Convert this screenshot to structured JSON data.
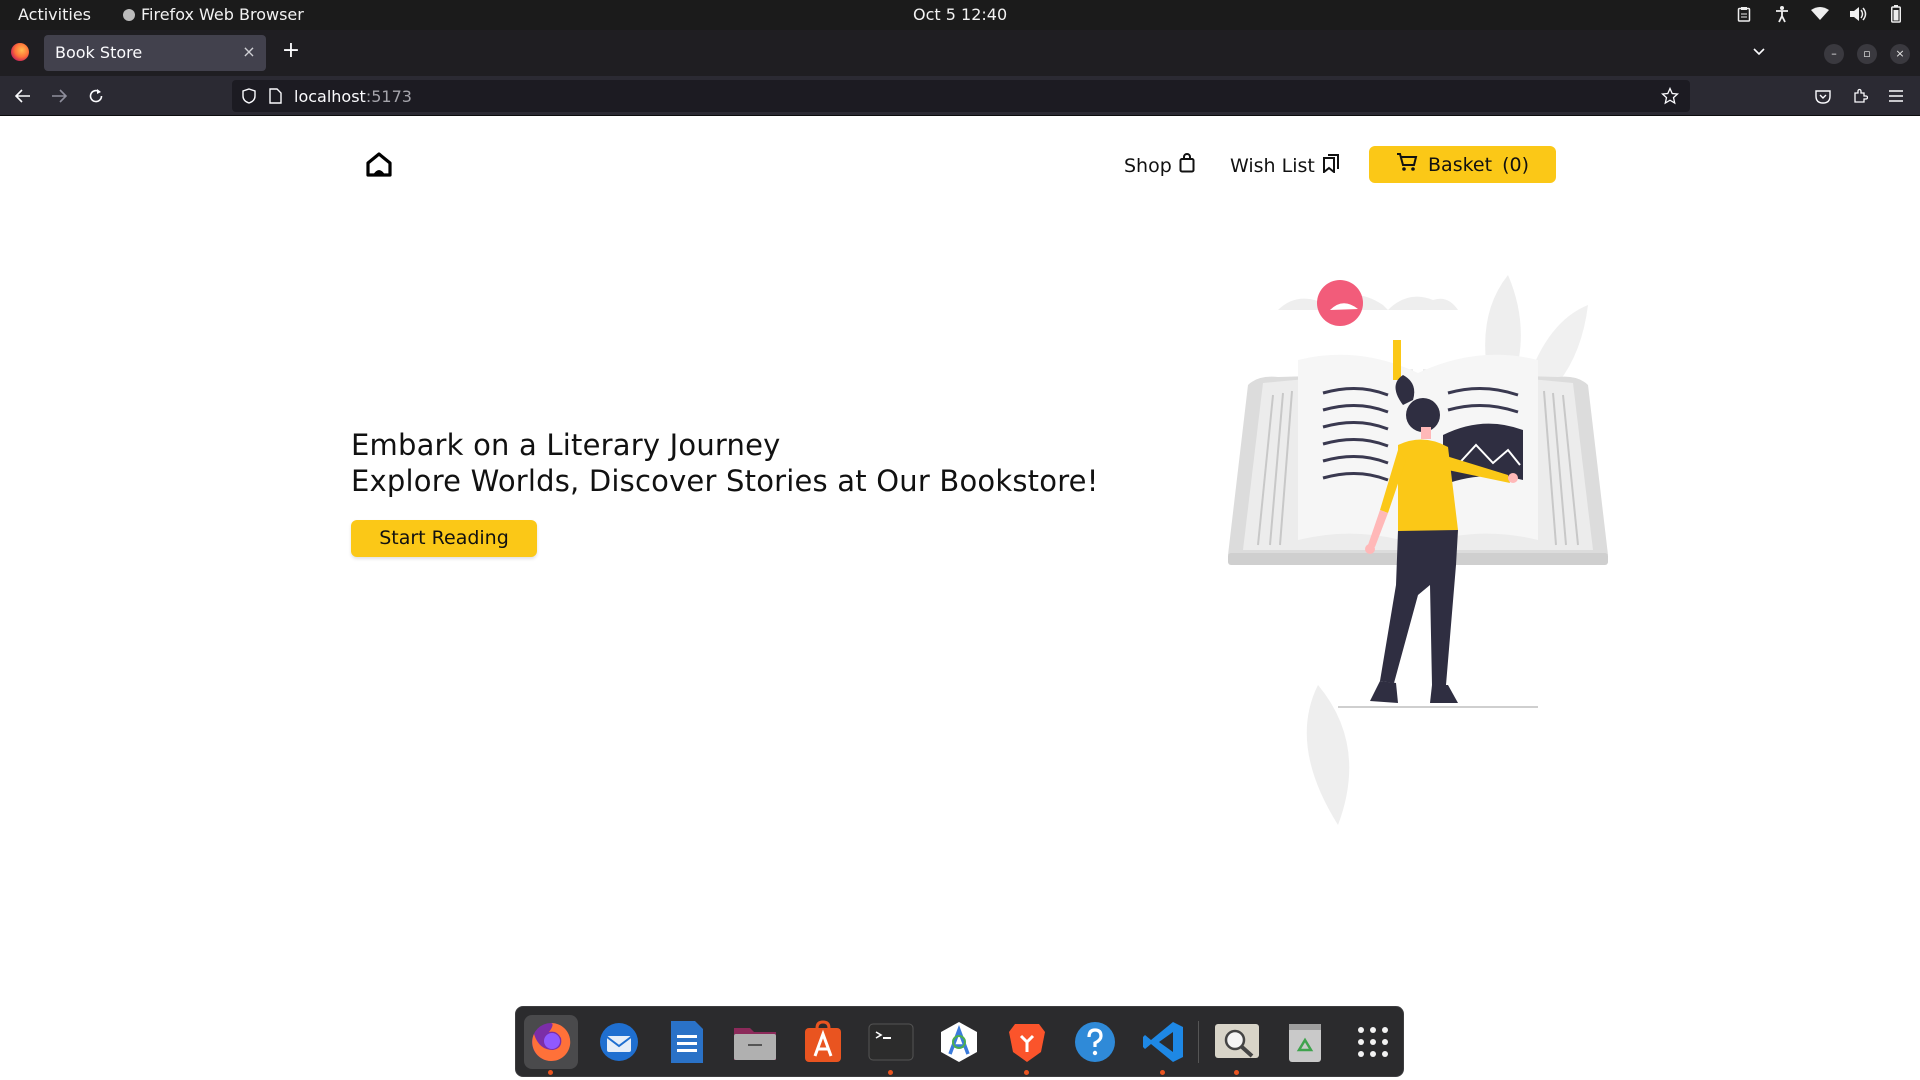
{
  "system_bar": {
    "activities": "Activities",
    "app_name": "Firefox Web Browser",
    "clock": "Oct 5  12:40",
    "tray_icons": [
      "clipboard-icon",
      "accessibility-icon",
      "wifi-icon",
      "volume-icon",
      "battery-icon"
    ]
  },
  "browser": {
    "tab_title": "Book Store",
    "tab_close": "×",
    "new_tab": "+",
    "url_host": "localhost",
    "url_port": ":5173",
    "window_controls": {
      "minimize": "–",
      "restore": "▫",
      "close": "×"
    }
  },
  "site": {
    "nav": {
      "shop": "Shop",
      "wishlist": "Wish List",
      "basket_label": "Basket",
      "basket_count": "(0)"
    },
    "hero": {
      "line1": "Embark on a Literary Journey",
      "line2": "Explore Worlds, Discover Stories at Our Bookstore!",
      "cta": "Start Reading"
    }
  },
  "colors": {
    "accent_yellow": "#fbc817",
    "illustration_pink": "#f25c7a",
    "dock_running_dot": "#e95420"
  },
  "dock": {
    "items": [
      {
        "name": "firefox-icon",
        "running": true,
        "active": true
      },
      {
        "name": "thunderbird-icon",
        "running": false
      },
      {
        "name": "libreoffice-writer-icon",
        "running": false
      },
      {
        "name": "files-icon",
        "running": false
      },
      {
        "name": "app-center-icon",
        "running": false
      },
      {
        "name": "terminal-icon",
        "running": true
      },
      {
        "name": "android-studio-icon",
        "running": false
      },
      {
        "name": "brave-icon",
        "running": true
      },
      {
        "name": "help-icon",
        "running": false
      },
      {
        "name": "vscode-icon",
        "running": true
      },
      {
        "name": "image-viewer-icon",
        "running": true
      },
      {
        "name": "trash-icon",
        "running": false
      },
      {
        "name": "show-apps-icon",
        "running": false
      }
    ]
  }
}
